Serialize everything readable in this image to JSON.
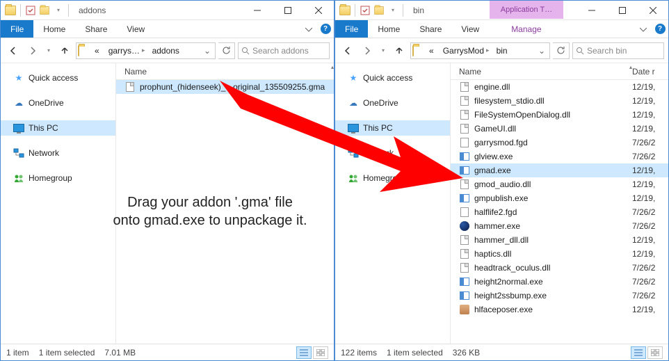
{
  "left": {
    "title": "addons",
    "ribbon": {
      "file": "File",
      "home": "Home",
      "share": "Share",
      "view": "View"
    },
    "breadcrumbs": [
      "garrys…",
      "addons"
    ],
    "search_placeholder": "Search addons",
    "columns": {
      "name": "Name"
    },
    "sidebar": {
      "quick_access": "Quick access",
      "onedrive": "OneDrive",
      "this_pc": "This PC",
      "network": "Network",
      "homegroup": "Homegroup"
    },
    "files": [
      {
        "name": "prophunt_(hidenseek)_-_original_135509255.gma",
        "type": "file",
        "selected": true
      }
    ],
    "status": {
      "count": "1 item",
      "selected": "1 item selected",
      "size": "7.01 MB"
    }
  },
  "right": {
    "title": "bin",
    "app_tools": "Application T…",
    "ribbon": {
      "file": "File",
      "home": "Home",
      "share": "Share",
      "view": "View",
      "manage": "Manage"
    },
    "breadcrumbs": [
      "GarrysMod",
      "bin"
    ],
    "search_placeholder": "Search bin",
    "columns": {
      "name": "Name",
      "date": "Date r"
    },
    "sidebar": {
      "quick_access": "Quick access",
      "onedrive": "OneDrive",
      "this_pc": "This PC",
      "network": "Network",
      "homegroup": "Homegroup"
    },
    "files": [
      {
        "name": "engine.dll",
        "type": "dll",
        "date": "12/19,"
      },
      {
        "name": "filesystem_stdio.dll",
        "type": "dll",
        "date": "12/19,"
      },
      {
        "name": "FileSystemOpenDialog.dll",
        "type": "dll",
        "date": "12/19,"
      },
      {
        "name": "GameUI.dll",
        "type": "dll",
        "date": "12/19,"
      },
      {
        "name": "garrysmod.fgd",
        "type": "fgd",
        "date": "7/26/2"
      },
      {
        "name": "glview.exe",
        "type": "exe",
        "date": "7/26/2"
      },
      {
        "name": "gmad.exe",
        "type": "exe",
        "date": "12/19,",
        "selected": true
      },
      {
        "name": "gmod_audio.dll",
        "type": "dll",
        "date": "12/19,"
      },
      {
        "name": "gmpublish.exe",
        "type": "exe",
        "date": "12/19,"
      },
      {
        "name": "halflife2.fgd",
        "type": "fgd",
        "date": "7/26/2"
      },
      {
        "name": "hammer.exe",
        "type": "hammer",
        "date": "7/26/2"
      },
      {
        "name": "hammer_dll.dll",
        "type": "dll",
        "date": "12/19,"
      },
      {
        "name": "haptics.dll",
        "type": "dll",
        "date": "12/19,"
      },
      {
        "name": "headtrack_oculus.dll",
        "type": "dll",
        "date": "7/26/2"
      },
      {
        "name": "height2normal.exe",
        "type": "exe",
        "date": "7/26/2"
      },
      {
        "name": "height2ssbump.exe",
        "type": "exe",
        "date": "7/26/2"
      },
      {
        "name": "hlfaceposer.exe",
        "type": "poser",
        "date": "12/19,"
      }
    ],
    "status": {
      "count": "122 items",
      "selected": "1 item selected",
      "size": "326 KB"
    }
  },
  "instruction": {
    "line1": "Drag your addon '.gma' file",
    "line2": "onto gmad.exe to unpackage it."
  }
}
